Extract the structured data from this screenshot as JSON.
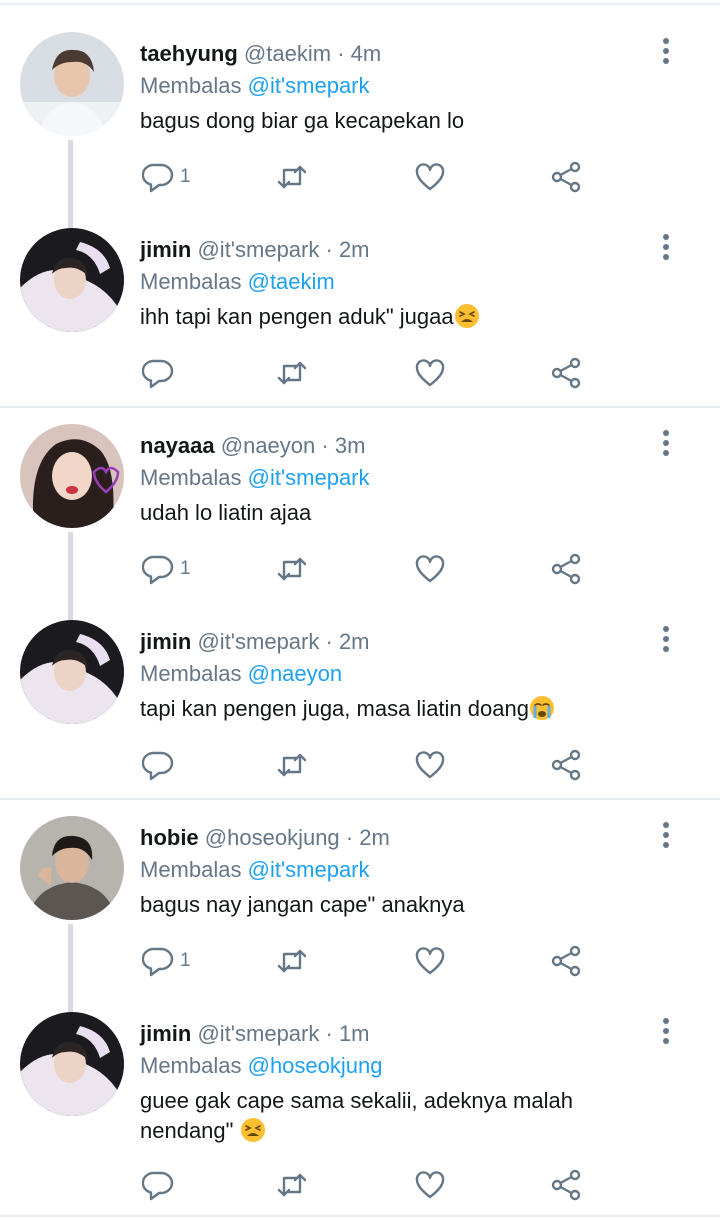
{
  "replying_prefix": "Membalas",
  "colors": {
    "accent": "#1da1f2",
    "muted": "#657786",
    "divider": "#e6ecf0",
    "thread_line": "#d5dbe0"
  },
  "icons": {
    "reply": "reply-icon",
    "retweet": "retweet-icon",
    "like": "heart-icon",
    "share": "share-icon",
    "more": "more-vertical-icon"
  },
  "tweets": [
    {
      "name": "taehyung",
      "handle": "@taekim",
      "time": "· 4m",
      "reply_to": "@it'smepark",
      "text": "bagus dong biar ga kecapekan lo",
      "emoji": "",
      "reply_count": "1"
    },
    {
      "name": "jimin",
      "handle": "@it'smepark",
      "time": "· 2m",
      "reply_to": "@taekim",
      "text": "ihh tapi kan pengen aduk\" jugaa",
      "emoji": "tired-face",
      "reply_count": ""
    },
    {
      "name": "nayaaa",
      "handle": "@naeyon",
      "time": "· 3m",
      "reply_to": "@it'smepark",
      "text": "udah lo liatin ajaa",
      "emoji": "",
      "reply_count": "1"
    },
    {
      "name": "jimin",
      "handle": "@it'smepark",
      "time": "· 2m",
      "reply_to": "@naeyon",
      "text": "tapi kan pengen juga, masa liatin doang",
      "emoji": "crying-face",
      "reply_count": ""
    },
    {
      "name": "hobie",
      "handle": "@hoseokjung",
      "time": "· 2m",
      "reply_to": "@it'smepark",
      "text": "bagus nay jangan cape\" anaknya",
      "emoji": "",
      "reply_count": "1"
    },
    {
      "name": "jimin",
      "handle": "@it'smepark",
      "time": "· 1m",
      "reply_to": "@hoseokjung",
      "text": "guee gak cape sama sekalii, adeknya malah nendang\" ",
      "emoji": "tired-face",
      "reply_count": ""
    }
  ]
}
